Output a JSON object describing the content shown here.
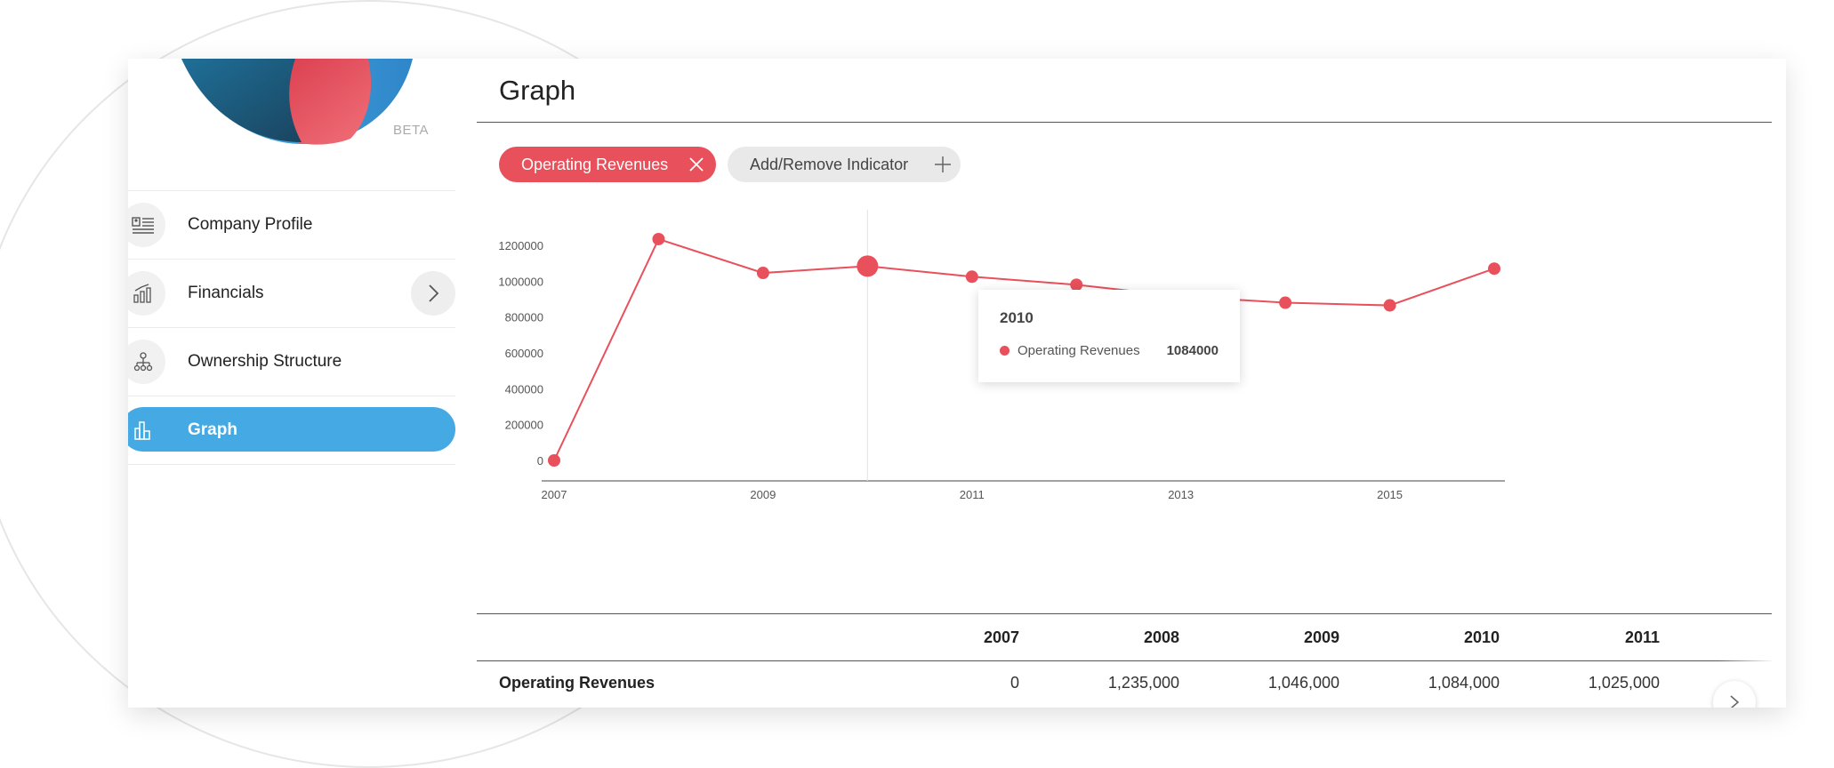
{
  "brand": {
    "badge": "BETA"
  },
  "sidebar": {
    "items": [
      {
        "label": "Company Profile",
        "icon": "profile-list-icon"
      },
      {
        "label": "Financials",
        "icon": "financials-chart-icon",
        "expandable": true
      },
      {
        "label": "Ownership Structure",
        "icon": "org-chart-icon"
      },
      {
        "label": "Graph",
        "icon": "bar-chart-icon",
        "active": true
      }
    ]
  },
  "main": {
    "title": "Graph",
    "chips": {
      "active_indicator": "Operating Revenues",
      "add_label": "Add/Remove Indicator"
    },
    "tooltip": {
      "year": "2010",
      "series": "Operating Revenues",
      "value": "1084000"
    },
    "table": {
      "headers": [
        "2007",
        "2008",
        "2009",
        "2010",
        "2011"
      ],
      "rows": [
        {
          "label": "Operating Revenues",
          "values": [
            "0",
            "1,235,000",
            "1,046,000",
            "1,084,000",
            "1,025,000"
          ]
        }
      ]
    }
  },
  "colors": {
    "series": "#e8505b",
    "accent": "#45a9e3"
  },
  "chart_data": {
    "type": "line",
    "x": [
      2007,
      2008,
      2009,
      2010,
      2011,
      2012,
      2013,
      2014,
      2015,
      2016
    ],
    "series": [
      {
        "name": "Operating Revenues",
        "values": [
          0,
          1235000,
          1046000,
          1084000,
          1025000,
          980000,
          915000,
          880000,
          865000,
          1070000
        ]
      }
    ],
    "x_tick_labels": [
      "2007",
      "2009",
      "2011",
      "2013",
      "2015"
    ],
    "y_tick_labels": [
      "0",
      "200000",
      "400000",
      "600000",
      "800000",
      "1000000",
      "1200000"
    ],
    "ylim": [
      0,
      1300000
    ],
    "highlighted_x": 2010,
    "grid": false
  }
}
